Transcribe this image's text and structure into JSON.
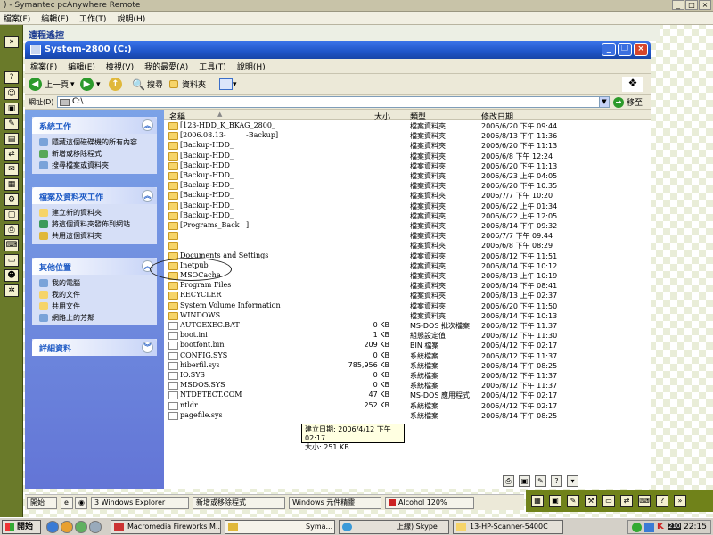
{
  "outer": {
    "title": ") - Symantec pcAnywhere Remote",
    "menu": [
      "檔案(F)",
      "編輯(E)",
      "工作(T)",
      "說明(H)"
    ],
    "panel_label": "遠程遙控"
  },
  "explorer": {
    "title": "System-2800 (C:)",
    "menu": [
      "檔案(F)",
      "編輯(E)",
      "檢視(V)",
      "我的最愛(A)",
      "工具(T)",
      "說明(H)"
    ],
    "toolbar": {
      "back": "上一頁",
      "search": "搜尋",
      "folders": "資料夾"
    },
    "address": {
      "label": "網址(D)",
      "value": "C:\\",
      "go": "移至"
    }
  },
  "task_pane": {
    "system_tasks": {
      "title": "系統工作",
      "items": [
        "隱藏這個磁碟機的所有內容",
        "新增或移除程式",
        "搜尋檔案或資料夾"
      ]
    },
    "file_tasks": {
      "title": "檔案及資料夾工作",
      "items": [
        "建立新的資料夾",
        "將這個資料夾發佈到網站",
        "共用這個資料夾"
      ]
    },
    "other_places": {
      "title": "其他位置",
      "items": [
        "我的電腦",
        "我的文件",
        "共用文件",
        "網路上的芳鄰"
      ]
    },
    "details": {
      "title": "詳細資料"
    }
  },
  "file_list": {
    "columns": {
      "name": "名稱",
      "size": "大小",
      "type": "類型",
      "modified": "修改日期"
    },
    "rows": [
      {
        "icon": "folder",
        "name": "[123-HDD_K_BKAG_2800_",
        "size": "",
        "type": "檔案資料夾",
        "date": "2006/6/20 下午 09:44"
      },
      {
        "icon": "folder",
        "name": "[2006.08.13-",
        "name2": "-Backup]",
        "size": "",
        "type": "檔案資料夾",
        "date": "2006/8/13 下午 11:36"
      },
      {
        "icon": "folder",
        "name": "[Backup-HDD_",
        "size": "",
        "type": "檔案資料夾",
        "date": "2006/6/20 下午 11:13"
      },
      {
        "icon": "folder",
        "name": "[Backup-HDD_",
        "size": "",
        "type": "檔案資料夾",
        "date": "2006/6/8 下午 12:24"
      },
      {
        "icon": "folder",
        "name": "[Backup-HDD_",
        "size": "",
        "type": "檔案資料夾",
        "date": "2006/6/20 下午 11:13"
      },
      {
        "icon": "folder",
        "name": "[Backup-HDD_",
        "size": "",
        "type": "檔案資料夾",
        "date": "2006/6/23 上午 04:05"
      },
      {
        "icon": "folder",
        "name": "[Backup-HDD_",
        "size": "",
        "type": "檔案資料夾",
        "date": "2006/6/20 下午 10:35"
      },
      {
        "icon": "folder",
        "name": "[Backup-HDD_",
        "size": "",
        "type": "檔案資料夾",
        "date": "2006/7/7 下午 10:20"
      },
      {
        "icon": "folder",
        "name": "[Backup-HDD_",
        "size": "",
        "type": "檔案資料夾",
        "date": "2006/6/22 上午 01:34"
      },
      {
        "icon": "folder",
        "name": "[Backup-HDD_",
        "size": "",
        "type": "檔案資料夾",
        "date": "2006/6/22 上午 12:05"
      },
      {
        "icon": "folder",
        "name": "[Programs_Back",
        "name2": "]",
        "size": "",
        "type": "檔案資料夾",
        "date": "2006/8/14 下午 09:32"
      },
      {
        "icon": "folder",
        "name": "",
        "size": "",
        "type": "檔案資料夾",
        "date": "2006/7/7 下午 09:44"
      },
      {
        "icon": "folder",
        "name": "",
        "size": "",
        "type": "檔案資料夾",
        "date": "2006/6/8 下午 08:29"
      },
      {
        "icon": "folder",
        "name": "Documents and Settings",
        "size": "",
        "type": "檔案資料夾",
        "date": "2006/8/12 下午 11:51"
      },
      {
        "icon": "folder",
        "name": "Inetpub",
        "size": "",
        "type": "檔案資料夾",
        "date": "2006/8/14 下午 10:12"
      },
      {
        "icon": "folder",
        "name": "MSOCache",
        "size": "",
        "type": "檔案資料夾",
        "date": "2006/8/13 上午 10:19"
      },
      {
        "icon": "folder",
        "name": "Program Files",
        "size": "",
        "type": "檔案資料夾",
        "date": "2006/8/14 下午 08:41"
      },
      {
        "icon": "folder",
        "name": "RECYCLER",
        "size": "",
        "type": "檔案資料夾",
        "date": "2006/8/13 上午 02:37"
      },
      {
        "icon": "folder",
        "name": "System Volume Information",
        "size": "",
        "type": "檔案資料夾",
        "date": "2006/6/20 下午 11:50"
      },
      {
        "icon": "folder",
        "name": "WINDOWS",
        "size": "",
        "type": "檔案資料夾",
        "date": "2006/8/14 下午 10:13"
      },
      {
        "icon": "file",
        "name": "AUTOEXEC.BAT",
        "size": "0 KB",
        "type": "MS-DOS 批次檔案",
        "date": "2006/8/12 下午 11:37"
      },
      {
        "icon": "file",
        "name": "boot.ini",
        "size": "1 KB",
        "type": "組態設定值",
        "date": "2006/8/12 下午 11:30"
      },
      {
        "icon": "file",
        "name": "bootfont.bin",
        "size": "209 KB",
        "type": "BIN 檔案",
        "date": "2006/4/12 下午 02:17"
      },
      {
        "icon": "file",
        "name": "CONFIG.SYS",
        "size": "0 KB",
        "type": "系統檔案",
        "date": "2006/8/12 下午 11:37"
      },
      {
        "icon": "file",
        "name": "hiberfil.sys",
        "size": "785,956 KB",
        "type": "系統檔案",
        "date": "2006/8/14 下午 08:25"
      },
      {
        "icon": "file",
        "name": "IO.SYS",
        "size": "0 KB",
        "type": "系統檔案",
        "date": "2006/8/12 下午 11:37"
      },
      {
        "icon": "file",
        "name": "MSDOS.SYS",
        "size": "0 KB",
        "type": "系統檔案",
        "date": "2006/8/12 下午 11:37"
      },
      {
        "icon": "file",
        "name": "NTDETECT.COM",
        "size": "47 KB",
        "type": "MS-DOS 應用程式",
        "date": "2006/4/12 下午 02:17"
      },
      {
        "icon": "file",
        "name": "ntldr",
        "size": "252 KB",
        "type": "系統檔案",
        "date": "2006/4/12 下午 02:17"
      },
      {
        "icon": "file",
        "name": "pagefile.sys",
        "size": "",
        "type": "系統檔案",
        "date": "2006/8/14 下午 08:25"
      }
    ],
    "tooltip": {
      "line1": "建立日期: 2006/4/12 下午 02:17",
      "line2": "大小: 251 KB"
    }
  },
  "remote_taskbar": {
    "start": "開始",
    "buttons": [
      "3 Windows Explorer",
      "新增或移除程式",
      "Windows 元件精靈",
      "Alcohol 120%"
    ]
  },
  "taskbar": {
    "start": "開始",
    "buttons": [
      "Macromedia Fireworks M...",
      "Syma...",
      "上線) Skype",
      "13-HP-Scanner-5400C"
    ],
    "tray_badge": "210",
    "clock": "22:15"
  }
}
